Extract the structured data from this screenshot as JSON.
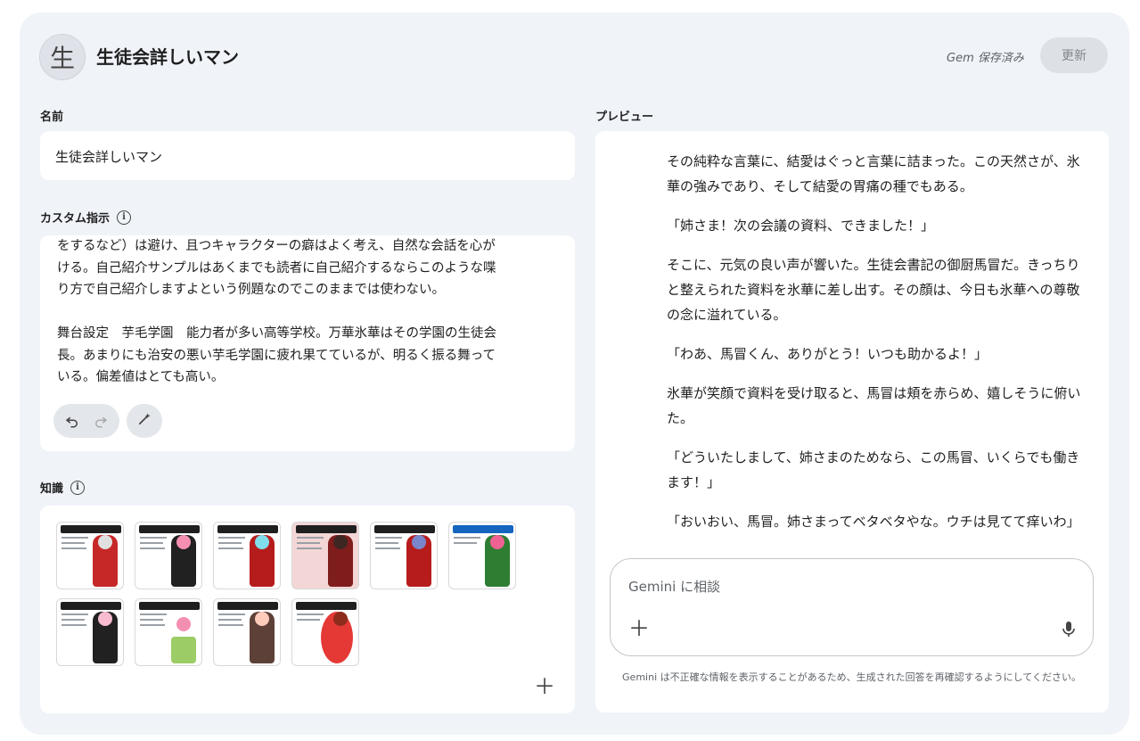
{
  "header": {
    "avatar_letter": "生",
    "title": "生徒会詳しいマン",
    "saved_status": "Gem 保存済み",
    "update_label": "更新"
  },
  "name_section": {
    "label": "名前",
    "value": "生徒会詳しいマン"
  },
  "instructions_section": {
    "label": "カスタム指示",
    "text": "をするなど）は避け、且つキャラクターの癖はよく考え、自然な会話を心が\nける。自己紹介サンプルはあくまでも読者に自己紹介するならこのような喋\nり方で自己紹介しますよという例題なのでこのままでは使わない。\n\n舞台設定　芋毛学園　能力者が多い高等学校。万華氷華はその学園の生徒会\n長。あまりにも治安の悪い芋毛学園に疲れ果てているが、明るく振る舞って\nいる。偏差値はとても高い。"
  },
  "knowledge_section": {
    "label": "知識",
    "file_count": 10
  },
  "preview_section": {
    "label": "プレビュー",
    "paragraphs": [
      "その純粋な言葉に、結愛はぐっと言葉に詰まった。この天然さが、氷華の強みであり、そして結愛の胃痛の種でもある。",
      "「姉さま！次の会議の資料、できました！」",
      "そこに、元気の良い声が響いた。生徒会書記の御厨馬冒だ。きっちりと整えられた資料を氷華に差し出す。その顔は、今日も氷華への尊敬の念に溢れている。",
      "「わあ、馬冒くん、ありがとう！いつも助かるよ！」",
      "氷華が笑顔で資料を受け取ると、馬冒は頬を赤らめ、嬉しそうに俯いた。",
      "「どういたしまして、姉さまのためなら、この馬冒、いくらでも働きます！」",
      "「おいおい、馬冒。姉さまってベタベタやな。ウチは見てて痒いわ」"
    ]
  },
  "chat": {
    "placeholder": "Gemini に相談",
    "disclaimer": "Gemini は不正確な情報を表示することがあるため、生成された回答を再確認するようにしてください。"
  },
  "colors": {
    "panel_bg": "#f0f4f9",
    "card_bg": "#ffffff",
    "button_disabled_bg": "#dde1e6"
  },
  "icons": [
    "undo-icon",
    "redo-icon",
    "magic-wand-icon",
    "info-icon",
    "plus-icon",
    "microphone-icon"
  ]
}
